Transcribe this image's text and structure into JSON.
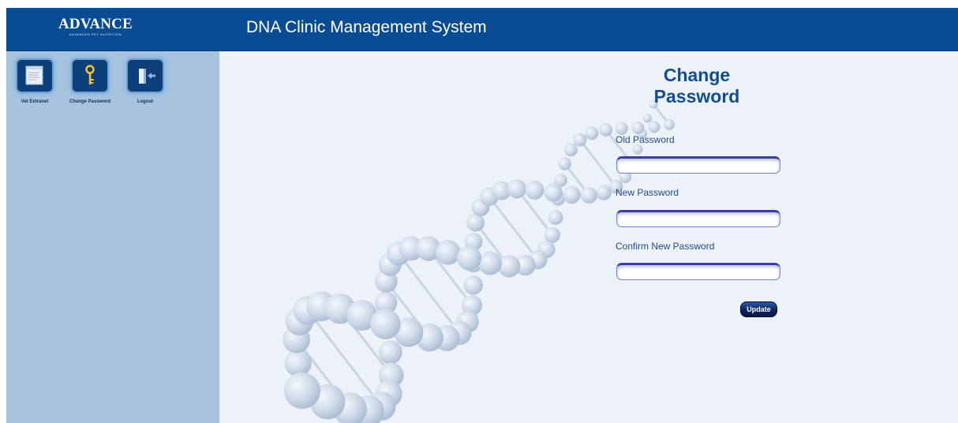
{
  "header": {
    "logo_text": "ADVANCE",
    "logo_subtext": "ADVANCED PET NUTRITION",
    "app_title": "DNA Clinic Management System"
  },
  "sidebar": {
    "items": [
      {
        "label": "Vet Extranet",
        "icon": "document-icon"
      },
      {
        "label": "Change Password",
        "icon": "key-icon"
      },
      {
        "label": "Logout",
        "icon": "logout-icon"
      }
    ]
  },
  "form": {
    "title_line1": "Change",
    "title_line2": "Password",
    "old_password_label": "Old Password",
    "old_password_value": "",
    "new_password_label": "New Password",
    "new_password_value": "",
    "confirm_password_label": "Confirm New Password",
    "confirm_password_value": "",
    "update_label": "Update"
  },
  "colors": {
    "header_bg": "#0a4c93",
    "sidebar_bg": "#a7c3de",
    "main_bg": "#edf1f8",
    "title_color": "#124d8e"
  }
}
